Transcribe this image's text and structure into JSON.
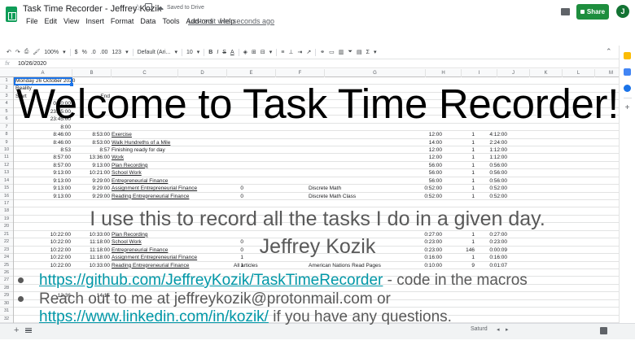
{
  "header": {
    "doc_title": "Task Time Recorder - Jeffrey Kozik",
    "saved_status": "Saved to Drive",
    "menu": [
      "File",
      "Edit",
      "View",
      "Insert",
      "Format",
      "Data",
      "Tools",
      "Add-ons",
      "Help"
    ],
    "last_edit": "Last edit was seconds ago",
    "share_label": "Share",
    "avatar_initial": "J",
    "brand_color": "#1e8e3e"
  },
  "toolbar": {
    "zoom": "100%",
    "currency": "$",
    "percent": "%",
    "decimal_less": ".0",
    "decimal_more": ".00",
    "number_format": "123",
    "font": "Default (Ari...",
    "font_size": "10",
    "bold": "B",
    "italic": "I",
    "strike": "S",
    "text_color": "A"
  },
  "formula_bar": {
    "fx": "fx",
    "value": "10/26/2020"
  },
  "grid": {
    "columns": [
      "A",
      "B",
      "C",
      "D",
      "E",
      "F",
      "G",
      "H",
      "I",
      "J",
      "K",
      "L",
      "M"
    ],
    "row_numbers": [
      "1",
      "2",
      "3",
      "4",
      "5",
      "6",
      "7",
      "8",
      "9",
      "10",
      "11",
      "12",
      "13",
      "14",
      "15",
      "16",
      "17",
      "18",
      "19",
      "20",
      "21",
      "22",
      "23",
      "24",
      "25",
      "26",
      "27",
      "28",
      "29",
      "30",
      "31",
      "32"
    ],
    "rows": [
      {
        "a": "Monday 26 October 2020",
        "a_left": true
      },
      {
        "a": "Reality",
        "a_left": true
      },
      {
        "a": "Start",
        "a_left": true,
        "b": "End"
      },
      {
        "a": "0:00:00"
      },
      {
        "a": "23:45:00"
      },
      {
        "a": "23:45:00"
      },
      {
        "a": "8:00"
      },
      {
        "a": "8:46:00",
        "b": "8:53:00",
        "task": "Exercise",
        "h": "12:00",
        "i": "1",
        "j": "4:12:00"
      },
      {
        "a": "8:46:00",
        "b": "8:53:00",
        "task": "Walk Hundreths of a Mile",
        "h": "14:00",
        "i": "1",
        "j": "2:24:00"
      },
      {
        "a": "8:53",
        "b": "8:57",
        "task_plain": "Finishing ready for day",
        "h": "12:00",
        "i": "1",
        "j": "1:12:00"
      },
      {
        "a": "8:57:00",
        "b": "13:36:00",
        "task": "Work",
        "h": "12:00",
        "i": "1",
        "j": "1:12:00"
      },
      {
        "a": "8:57:00",
        "b": "9:13:00",
        "task": "Plan Recording",
        "h": "56:00",
        "i": "1",
        "j": "0:56:00"
      },
      {
        "a": "9:13:00",
        "b": "10:21:00",
        "task": "School Work",
        "h": "56:00",
        "i": "1",
        "j": "0:56:00"
      },
      {
        "a": "9:13:00",
        "b": "9:29:00",
        "task": "Entrepreneurial Finance",
        "h": "56:00",
        "i": "1",
        "j": "0:56:00"
      },
      {
        "a": "9:13:00",
        "b": "9:29:00",
        "task": "Assignment Entrepreneurial Finance",
        "d": "0",
        "g": "Discrete Math",
        "h": "0:52:00",
        "i": "1",
        "j": "0:52:00"
      },
      {
        "a": "9:13:00",
        "b": "9:29:00",
        "task": "Reading Entrepreneurial Finance",
        "d": "0",
        "g": "Discrete Math Class",
        "h": "0:52:00",
        "i": "1",
        "j": "0:52:00"
      },
      {},
      {},
      {},
      {},
      {
        "a": "10:22:00",
        "b": "10:33:00",
        "task": "Plan Recording",
        "h": "0:27:00",
        "i": "1",
        "j": "0:27:00"
      },
      {
        "a": "10:22:00",
        "b": "11:18:00",
        "task": "School Work",
        "d": "0",
        "h": "0:23:00",
        "i": "1",
        "j": "0:23:00"
      },
      {
        "a": "10:22:00",
        "b": "11:18:00",
        "task": "Entrepreneurial Finance",
        "d": "0",
        "h": "0:23:00",
        "i": "146",
        "j": "0:00:09"
      },
      {
        "a": "10:22:00",
        "b": "11:18:00",
        "task": "Assignment Entrepreneurial Finance",
        "d": "1",
        "h": "0:16:00",
        "i": "1",
        "j": "0:16:00"
      },
      {
        "a": "10:22:00",
        "b": "10:33:00",
        "task": "Reading Entrepreneurial Finance",
        "d": "1",
        "f": "All articles",
        "g": "American Nations Read Pages",
        "h": "0:10:00",
        "i": "9",
        "j": "0:01:07"
      },
      {},
      {},
      {},
      {
        "a": "13:36",
        "b": "14:15"
      },
      {},
      {},
      {}
    ]
  },
  "sheet_bar": {
    "add": "+",
    "tab_label": "Saturd"
  },
  "overlay": {
    "title": "Welcome to Task Time Recorder!",
    "subtitle": "I use this to record all the tasks I do in a given day.",
    "name": "Jeffrey Kozik",
    "bullet1_link": "https://github.com/JeffreyKozik/TaskTimeRecorder",
    "bullet1_text": " - code in the macros",
    "bullet2_text": "Reach out to me at jeffreykozik@protonmail.com or",
    "bullet2_link": "https://www.linkedin.com/in/kozik/",
    "bullet2_tail": " if you have any questions.",
    "text_color": "#595959",
    "link_color": "#0097a7"
  }
}
